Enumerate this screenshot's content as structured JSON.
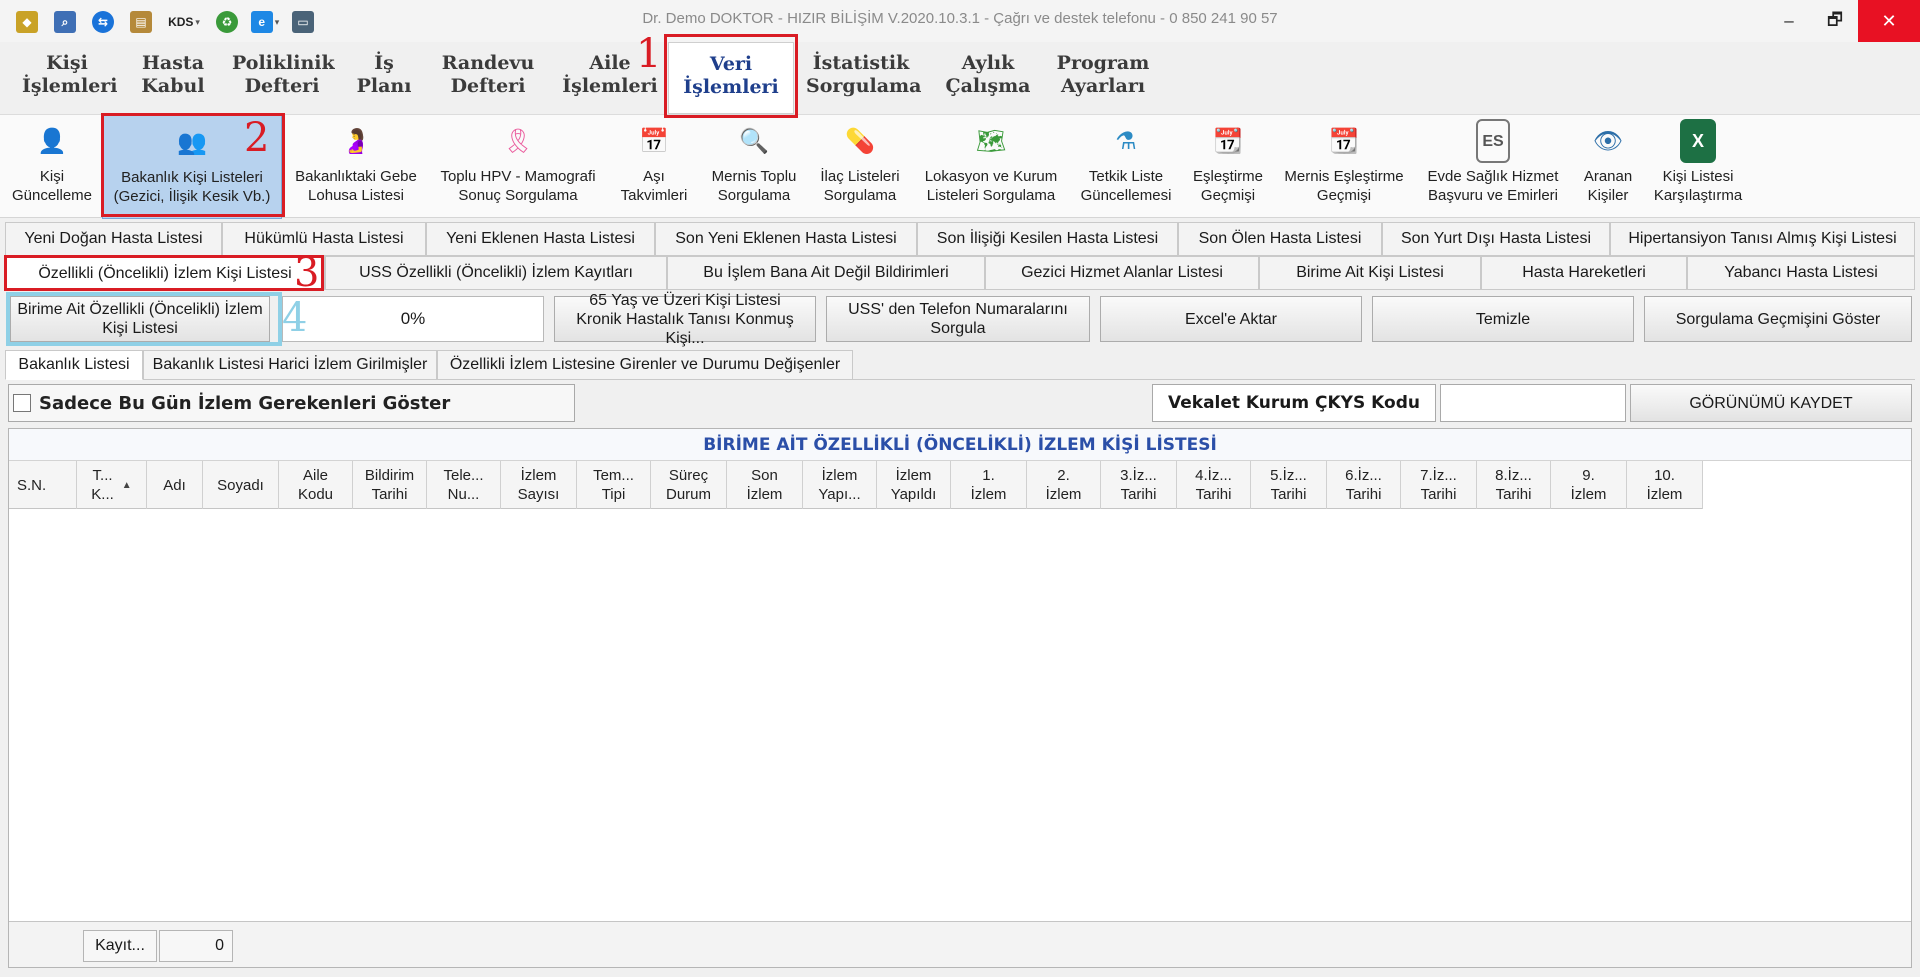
{
  "window": {
    "title": "Dr. Demo DOKTOR - HIZIR BİLİŞİM V.2020.10.3.1 - Çağrı ve destek telefonu - 0 850 241 90 57",
    "quick_access": [
      {
        "icon": "app-logo-icon"
      },
      {
        "icon": "search-doc-icon"
      },
      {
        "icon": "teamviewer-icon"
      },
      {
        "icon": "clipboard-icon"
      },
      {
        "label": "KDS",
        "icon": "kds-icon"
      },
      {
        "icon": "recycle-icon"
      },
      {
        "icon": "browser-icon"
      },
      {
        "icon": "scanner-icon"
      }
    ],
    "buttons": {
      "minimize": "–",
      "restore": "🗗",
      "close": "✕"
    }
  },
  "menu": [
    {
      "line1": "Kişi",
      "line2": "İşlemleri"
    },
    {
      "line1": "Hasta",
      "line2": "Kabul"
    },
    {
      "line1": "Poliklinik",
      "line2": "Defteri"
    },
    {
      "line1": "İş",
      "line2": "Planı"
    },
    {
      "line1": "Randevu",
      "line2": "Defteri"
    },
    {
      "line1": "Aile",
      "line2": "İşlemleri"
    },
    {
      "line1": "Veri",
      "line2": "İşlemleri"
    },
    {
      "line1": "İstatistik",
      "line2": "Sorgulama"
    },
    {
      "line1": "Aylık",
      "line2": "Çalışma"
    },
    {
      "line1": "Program",
      "line2": "Ayarları"
    }
  ],
  "annotations": {
    "n1": "1",
    "n2": "2",
    "n3": "3",
    "n4": "4"
  },
  "ribbon": [
    {
      "line1": "Kişi",
      "line2": "Güncelleme",
      "icon": "person-update-icon"
    },
    {
      "line1": "Bakanlık Kişi Listeleri",
      "line2": "(Gezici, İlişik Kesik Vb.)",
      "icon": "people-group-icon"
    },
    {
      "line1": "Bakanlıktaki Gebe",
      "line2": "Lohusa Listesi",
      "icon": "pregnant-icon"
    },
    {
      "line1": "Toplu HPV - Mamografi",
      "line2": "Sonuç Sorgulama",
      "icon": "pink-ribbon-icon"
    },
    {
      "line1": "Aşı",
      "line2": "Takvimleri",
      "icon": "calendar-icon"
    },
    {
      "line1": "Mernis Toplu",
      "line2": "Sorgulama",
      "icon": "magnifier-doc-icon"
    },
    {
      "line1": "İlaç Listeleri",
      "line2": "Sorgulama",
      "icon": "pill-icon"
    },
    {
      "line1": "Lokasyon ve Kurum",
      "line2": "Listeleri Sorgulama",
      "icon": "map-pin-icon"
    },
    {
      "line1": "Tetkik Liste",
      "line2": "Güncellemesi",
      "icon": "flask-refresh-icon"
    },
    {
      "line1": "Eşleştirme",
      "line2": "Geçmişi",
      "icon": "calendar-clock-icon"
    },
    {
      "line1": "Mernis Eşleştirme",
      "line2": "Geçmişi",
      "icon": "calendar-clock-icon"
    },
    {
      "line1": "Evde Sağlık Hizmet",
      "line2": "Başvuru ve Emirleri",
      "icon": "es-clipboard-icon"
    },
    {
      "line1": "Aranan",
      "line2": "Kişiler",
      "icon": "eye-icon"
    },
    {
      "line1": "Kişi Listesi",
      "line2": "Karşılaştırma",
      "icon": "excel-icon"
    }
  ],
  "tabs_row1": [
    "Yeni Doğan Hasta Listesi",
    "Hükümlü Hasta Listesi",
    "Yeni Eklenen Hasta Listesi",
    "Son Yeni Eklenen Hasta Listesi",
    "Son İlişiği Kesilen Hasta Listesi",
    "Son Ölen Hasta Listesi",
    "Son Yurt Dışı Hasta Listesi",
    "Hipertansiyon Tanısı Almış Kişi Listesi"
  ],
  "tabs_row2": [
    "Özellikli (Öncelikli) İzlem Kişi Listesi",
    "USS Özellikli (Öncelikli) İzlem Kayıtları",
    "Bu İşlem Bana Ait Değil Bildirimleri",
    "Gezici Hizmet Alanlar Listesi",
    "Birime Ait Kişi Listesi",
    "Hasta Hareketleri",
    "Yabancı Hasta Listesi"
  ],
  "actions": {
    "birime_line1": "Birime Ait Özellikli (Öncelikli) İzlem",
    "birime_line2": "Kişi Listesi",
    "progress": "0%",
    "yas65_line1": "65 Yaş ve Üzeri Kişi Listesi",
    "yas65_line2": "Kronik Hastalık Tanısı Konmuş Kişi...",
    "uss_line1": "USS' den Telefon Numaralarını",
    "uss_line2": "Sorgula",
    "excel": "Excel'e Aktar",
    "temizle": "Temizle",
    "gecmis": "Sorgulama Geçmişini Göster"
  },
  "subtabs": [
    "Bakanlık Listesi",
    "Bakanlık Listesi Harici İzlem Girilmişler",
    "Özellikli İzlem Listesine Girenler ve Durumu Değişenler"
  ],
  "filter": {
    "checkbox_label": "Sadece Bu Gün İzlem Gerekenleri Göster",
    "vekalet_label": "Vekalet Kurum ÇKYS Kodu",
    "vekalet_value": "",
    "save_view": "GÖRÜNÜMÜ KAYDET"
  },
  "grid": {
    "title": "BİRİME AİT ÖZELLİKLİ (ÖNCELİKLİ) İZLEM KİŞİ LİSTESİ",
    "columns": [
      {
        "l1": "S.N.",
        "l2": ""
      },
      {
        "l1": "T...",
        "l2": "K..."
      },
      {
        "l1": "Adı",
        "l2": ""
      },
      {
        "l1": "Soyadı",
        "l2": ""
      },
      {
        "l1": "Aile",
        "l2": "Kodu"
      },
      {
        "l1": "Bildirim",
        "l2": "Tarihi"
      },
      {
        "l1": "Tele...",
        "l2": "Nu..."
      },
      {
        "l1": "İzlem",
        "l2": "Sayısı"
      },
      {
        "l1": "Tem...",
        "l2": "Tipi"
      },
      {
        "l1": "Süreç",
        "l2": "Durum"
      },
      {
        "l1": "Son",
        "l2": "İzlem"
      },
      {
        "l1": "İzlem",
        "l2": "Yapı..."
      },
      {
        "l1": "İzlem",
        "l2": "Yapıldı"
      },
      {
        "l1": "1.",
        "l2": "İzlem"
      },
      {
        "l1": "2.",
        "l2": "İzlem"
      },
      {
        "l1": "3.İz...",
        "l2": "Tarihi"
      },
      {
        "l1": "4.İz...",
        "l2": "Tarihi"
      },
      {
        "l1": "5.İz...",
        "l2": "Tarihi"
      },
      {
        "l1": "6.İz...",
        "l2": "Tarihi"
      },
      {
        "l1": "7.İz...",
        "l2": "Tarihi"
      },
      {
        "l1": "8.İz...",
        "l2": "Tarihi"
      },
      {
        "l1": "9.",
        "l2": "İzlem"
      },
      {
        "l1": "10.",
        "l2": "İzlem"
      }
    ],
    "footer_button": "Kayıt...",
    "footer_count": "0"
  },
  "colors": {
    "accent_red": "#d91c24",
    "accent_blue": "#8fd0e6",
    "active_menu_text": "#1f3f8c",
    "grid_title": "#2b4fa8"
  }
}
